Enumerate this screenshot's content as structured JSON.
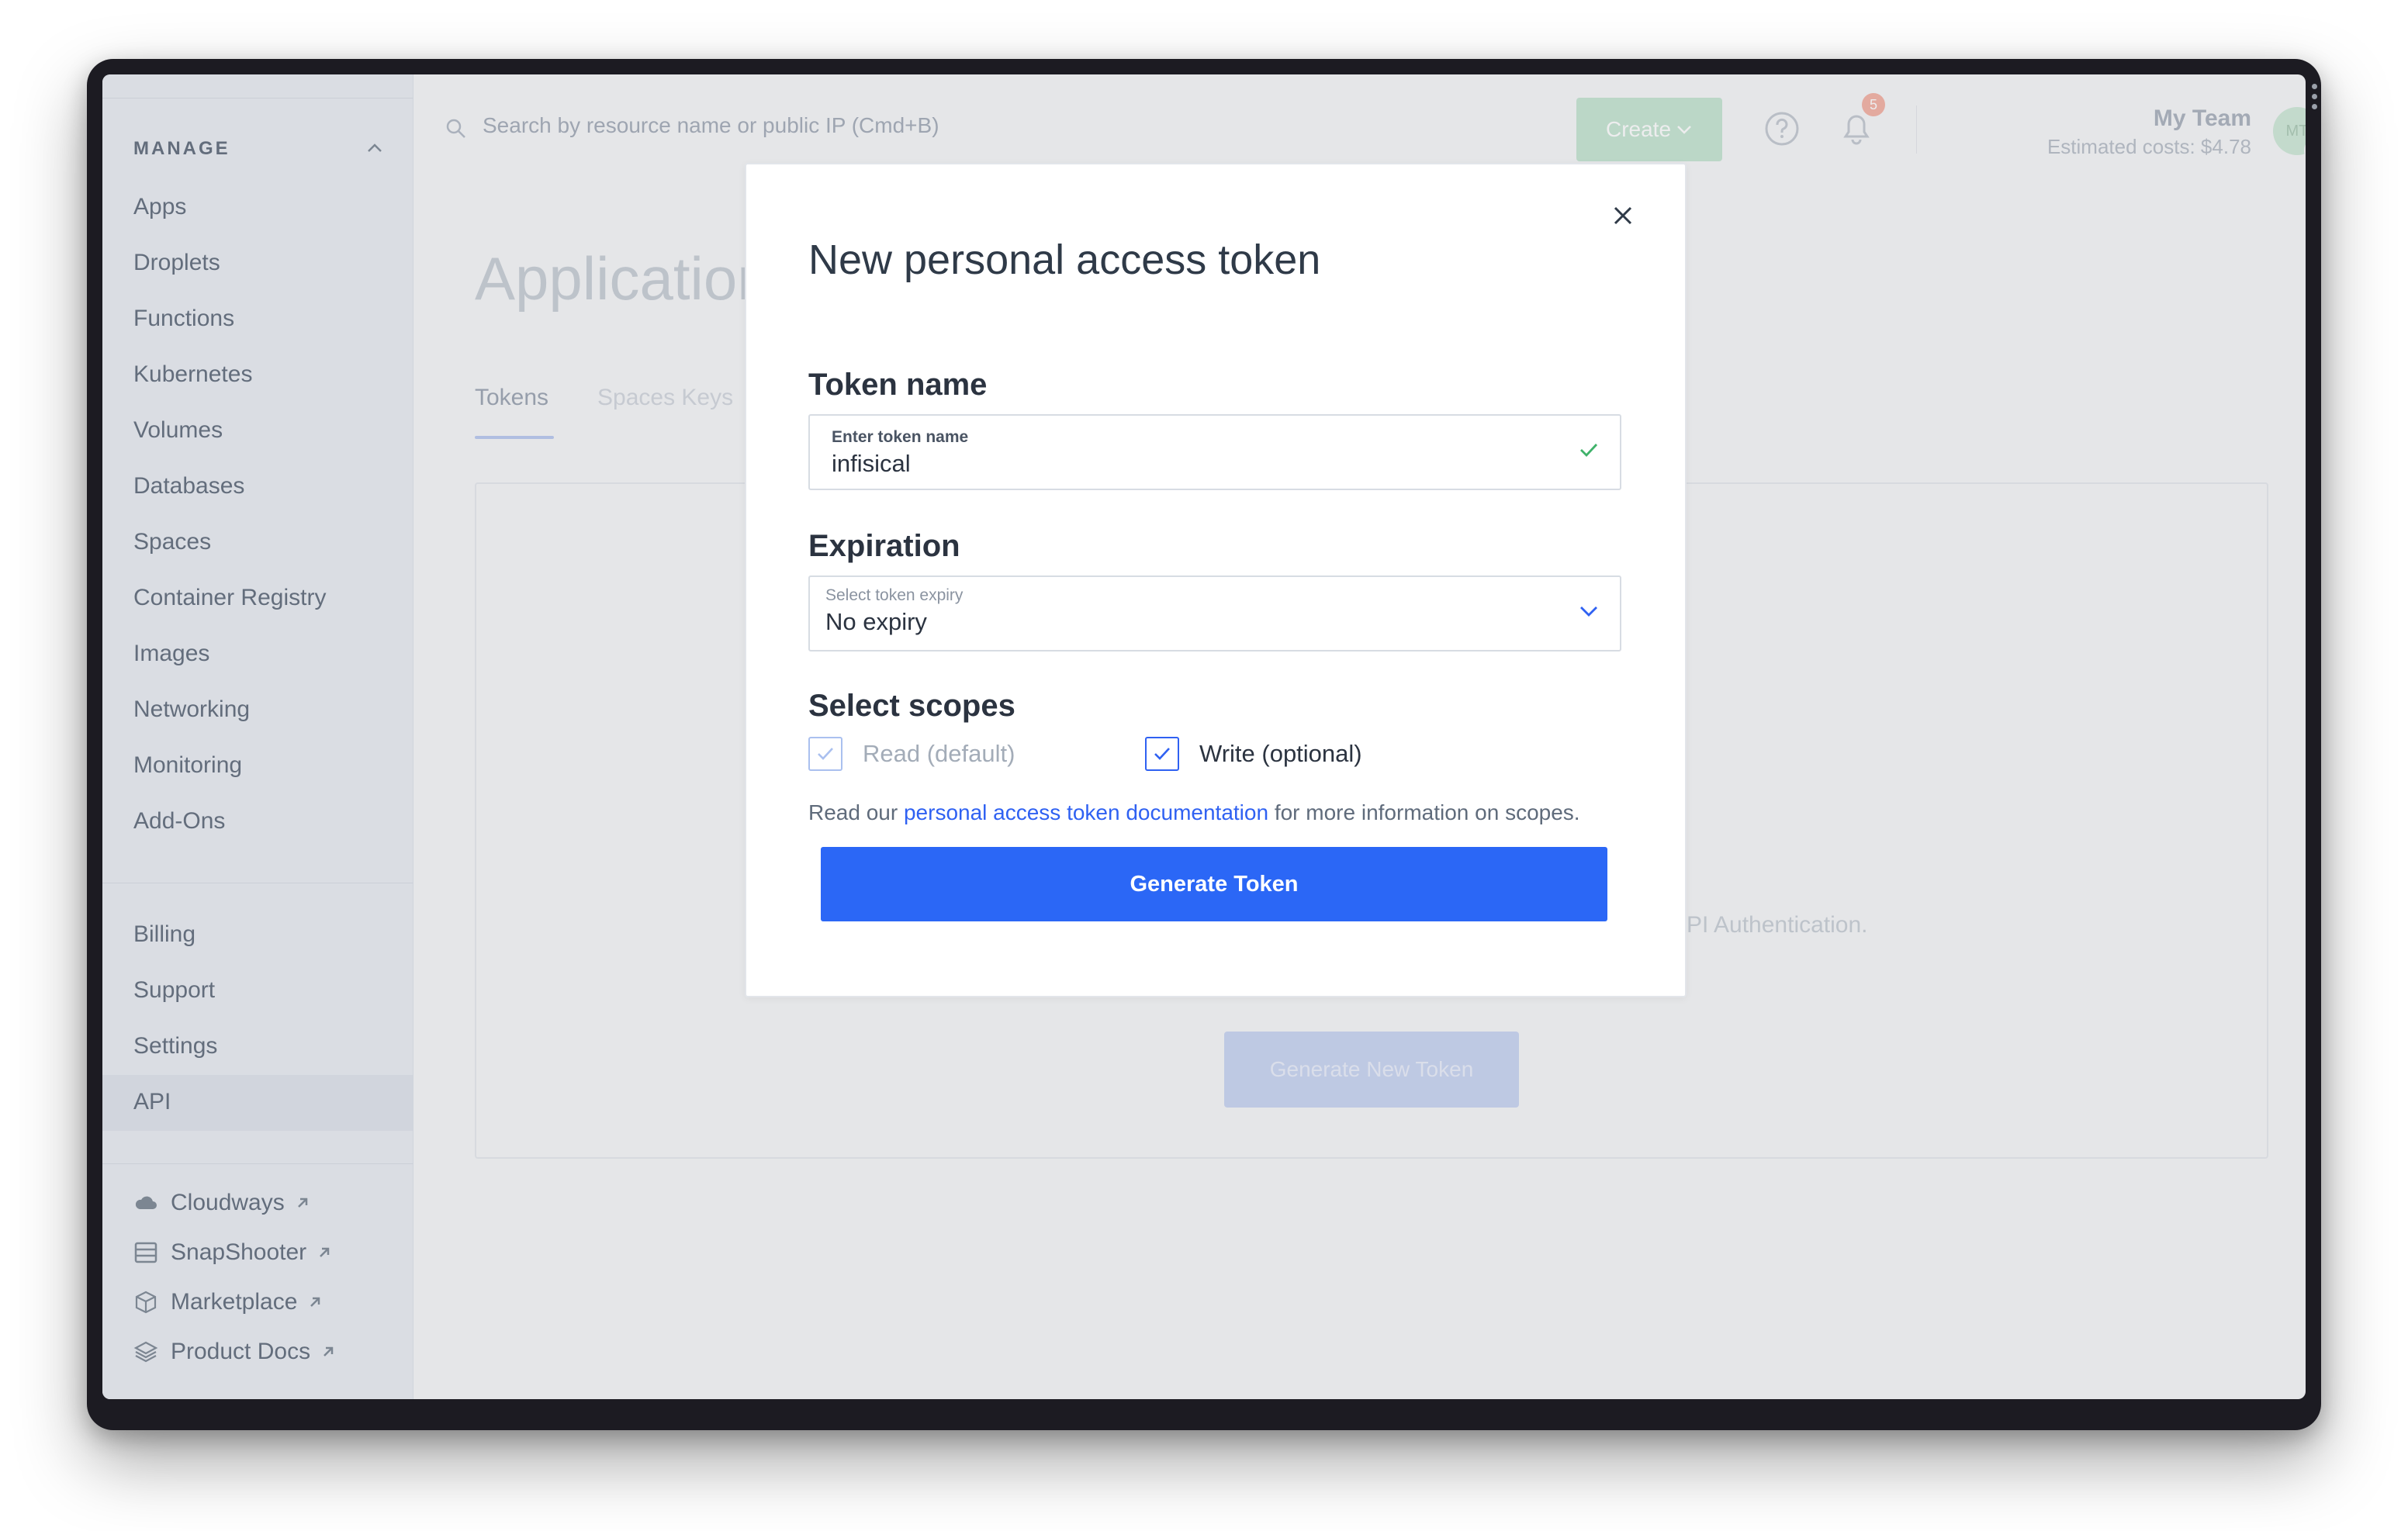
{
  "sidebar": {
    "heading": "MANAGE",
    "items": [
      {
        "label": "Apps"
      },
      {
        "label": "Droplets"
      },
      {
        "label": "Functions"
      },
      {
        "label": "Kubernetes"
      },
      {
        "label": "Volumes"
      },
      {
        "label": "Databases"
      },
      {
        "label": "Spaces"
      },
      {
        "label": "Container Registry"
      },
      {
        "label": "Images"
      },
      {
        "label": "Networking"
      },
      {
        "label": "Monitoring"
      },
      {
        "label": "Add-Ons"
      }
    ],
    "account_items": [
      {
        "label": "Billing"
      },
      {
        "label": "Support"
      },
      {
        "label": "Settings"
      },
      {
        "label": "API"
      }
    ],
    "active_item": "API",
    "external_links": [
      {
        "label": "Cloudways",
        "icon": "cloud-icon"
      },
      {
        "label": "SnapShooter",
        "icon": "snapshooter-icon"
      },
      {
        "label": "Marketplace",
        "icon": "cube-icon"
      },
      {
        "label": "Product Docs",
        "icon": "layers-icon"
      }
    ]
  },
  "header": {
    "search_placeholder": "Search by resource name or public IP (Cmd+B)",
    "create_label": "Create",
    "notification_count": "5",
    "team_name": "My Team",
    "estimated_costs": "Estimated costs: $4.78",
    "avatar_initials": "MT"
  },
  "page": {
    "title": "Applications & API",
    "tabs": [
      {
        "label": "Tokens",
        "active": true
      },
      {
        "label": "Spaces Keys",
        "active": false
      }
    ],
    "panel_text": "PI Authentication.",
    "generate_new_token_label": "Generate New Token"
  },
  "modal": {
    "title": "New personal access token",
    "token_name_section": "Token name",
    "token_name_field_label": "Enter token name",
    "token_name_value": "infisical",
    "expiration_section": "Expiration",
    "expiry_field_label": "Select token expiry",
    "expiry_value": "No expiry",
    "scopes_section": "Select scopes",
    "scope_read_label": "Read (default)",
    "scope_read_checked": true,
    "scope_write_label": "Write (optional)",
    "scope_write_checked": true,
    "info_prefix": "Read our ",
    "info_link": "personal access token documentation",
    "info_suffix": " for more information on scopes.",
    "generate_label": "Generate Token"
  },
  "colors": {
    "primary": "#2b67f6",
    "link": "#2f61f2",
    "success": "#3fb26a",
    "create_button": "#c5e6d2"
  }
}
